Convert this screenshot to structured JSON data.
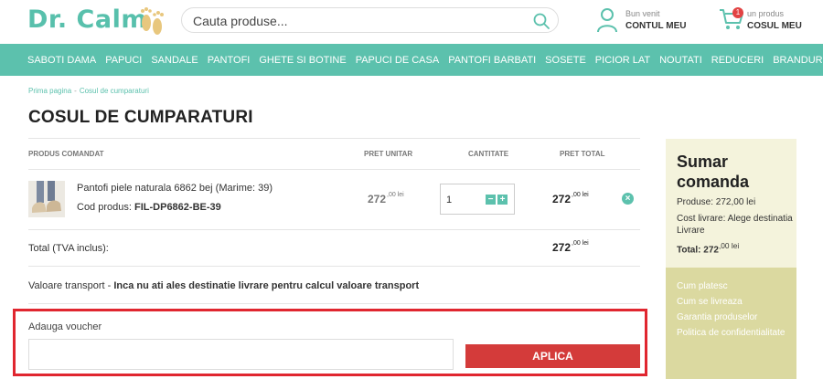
{
  "header": {
    "logo": "Dr. Calm",
    "search_placeholder": "Cauta produse...",
    "account_small": "Bun venit",
    "account_big": "CONTUL MEU",
    "cart_badge": "1",
    "cart_small": "un produs",
    "cart_big": "COSUL MEU"
  },
  "nav": [
    "SABOTI DAMA",
    "PAPUCI",
    "SANDALE",
    "PANTOFI",
    "GHETE SI BOTINE",
    "PAPUCI DE CASA",
    "PANTOFI BARBATI",
    "SOSETE",
    "PICIOR LAT",
    "NOUTATI",
    "REDUCERI",
    "BRANDURI"
  ],
  "breadcrumb": {
    "home": "Prima pagina",
    "sep": "-",
    "current": "Cosul de cumparaturi"
  },
  "page_title": "COSUL DE CUMPARATURI",
  "table_headers": {
    "product": "PRODUS COMANDAT",
    "unit_price": "PRET UNITAR",
    "quantity": "CANTITATE",
    "total": "PRET TOTAL"
  },
  "item": {
    "name": "Pantofi piele naturala 6862 bej (Marime: 39)",
    "code_label": "Cod produs:",
    "code": "FIL-DP6862-BE-39",
    "unit_price": "272",
    "unit_price_dec": ",00 lei",
    "quantity": "1",
    "minus": "−",
    "plus": "+",
    "total_price": "272",
    "total_price_dec": ",00 lei",
    "remove": "×"
  },
  "totals": {
    "label": "Total (TVA inclus):",
    "value": "272",
    "value_dec": ",00 lei"
  },
  "transport": {
    "label": "Valoare transport - ",
    "message": "Inca nu ati ales destinatie livrare pentru calcul valoare transport"
  },
  "voucher": {
    "label": "Adauga voucher",
    "value": "",
    "button": "APLICA"
  },
  "summary": {
    "title": "Sumar comanda",
    "products": "Produse: 272,00 lei",
    "shipping": "Cost livrare: Alege destinatia Livrare",
    "total_label": "Total:",
    "total_value": "272",
    "total_dec": ",00 lei",
    "links": [
      "Cum platesc",
      "Cum se livreaza",
      "Garantia produselor",
      "Politica de confidentialitate"
    ]
  },
  "colors": {
    "brand": "#5cc1ad",
    "accent_red": "#d43b3a",
    "highlight_border": "#e0262f",
    "summary_bg": "#f4f3dc",
    "summary_links_bg": "#dbd9a0"
  }
}
